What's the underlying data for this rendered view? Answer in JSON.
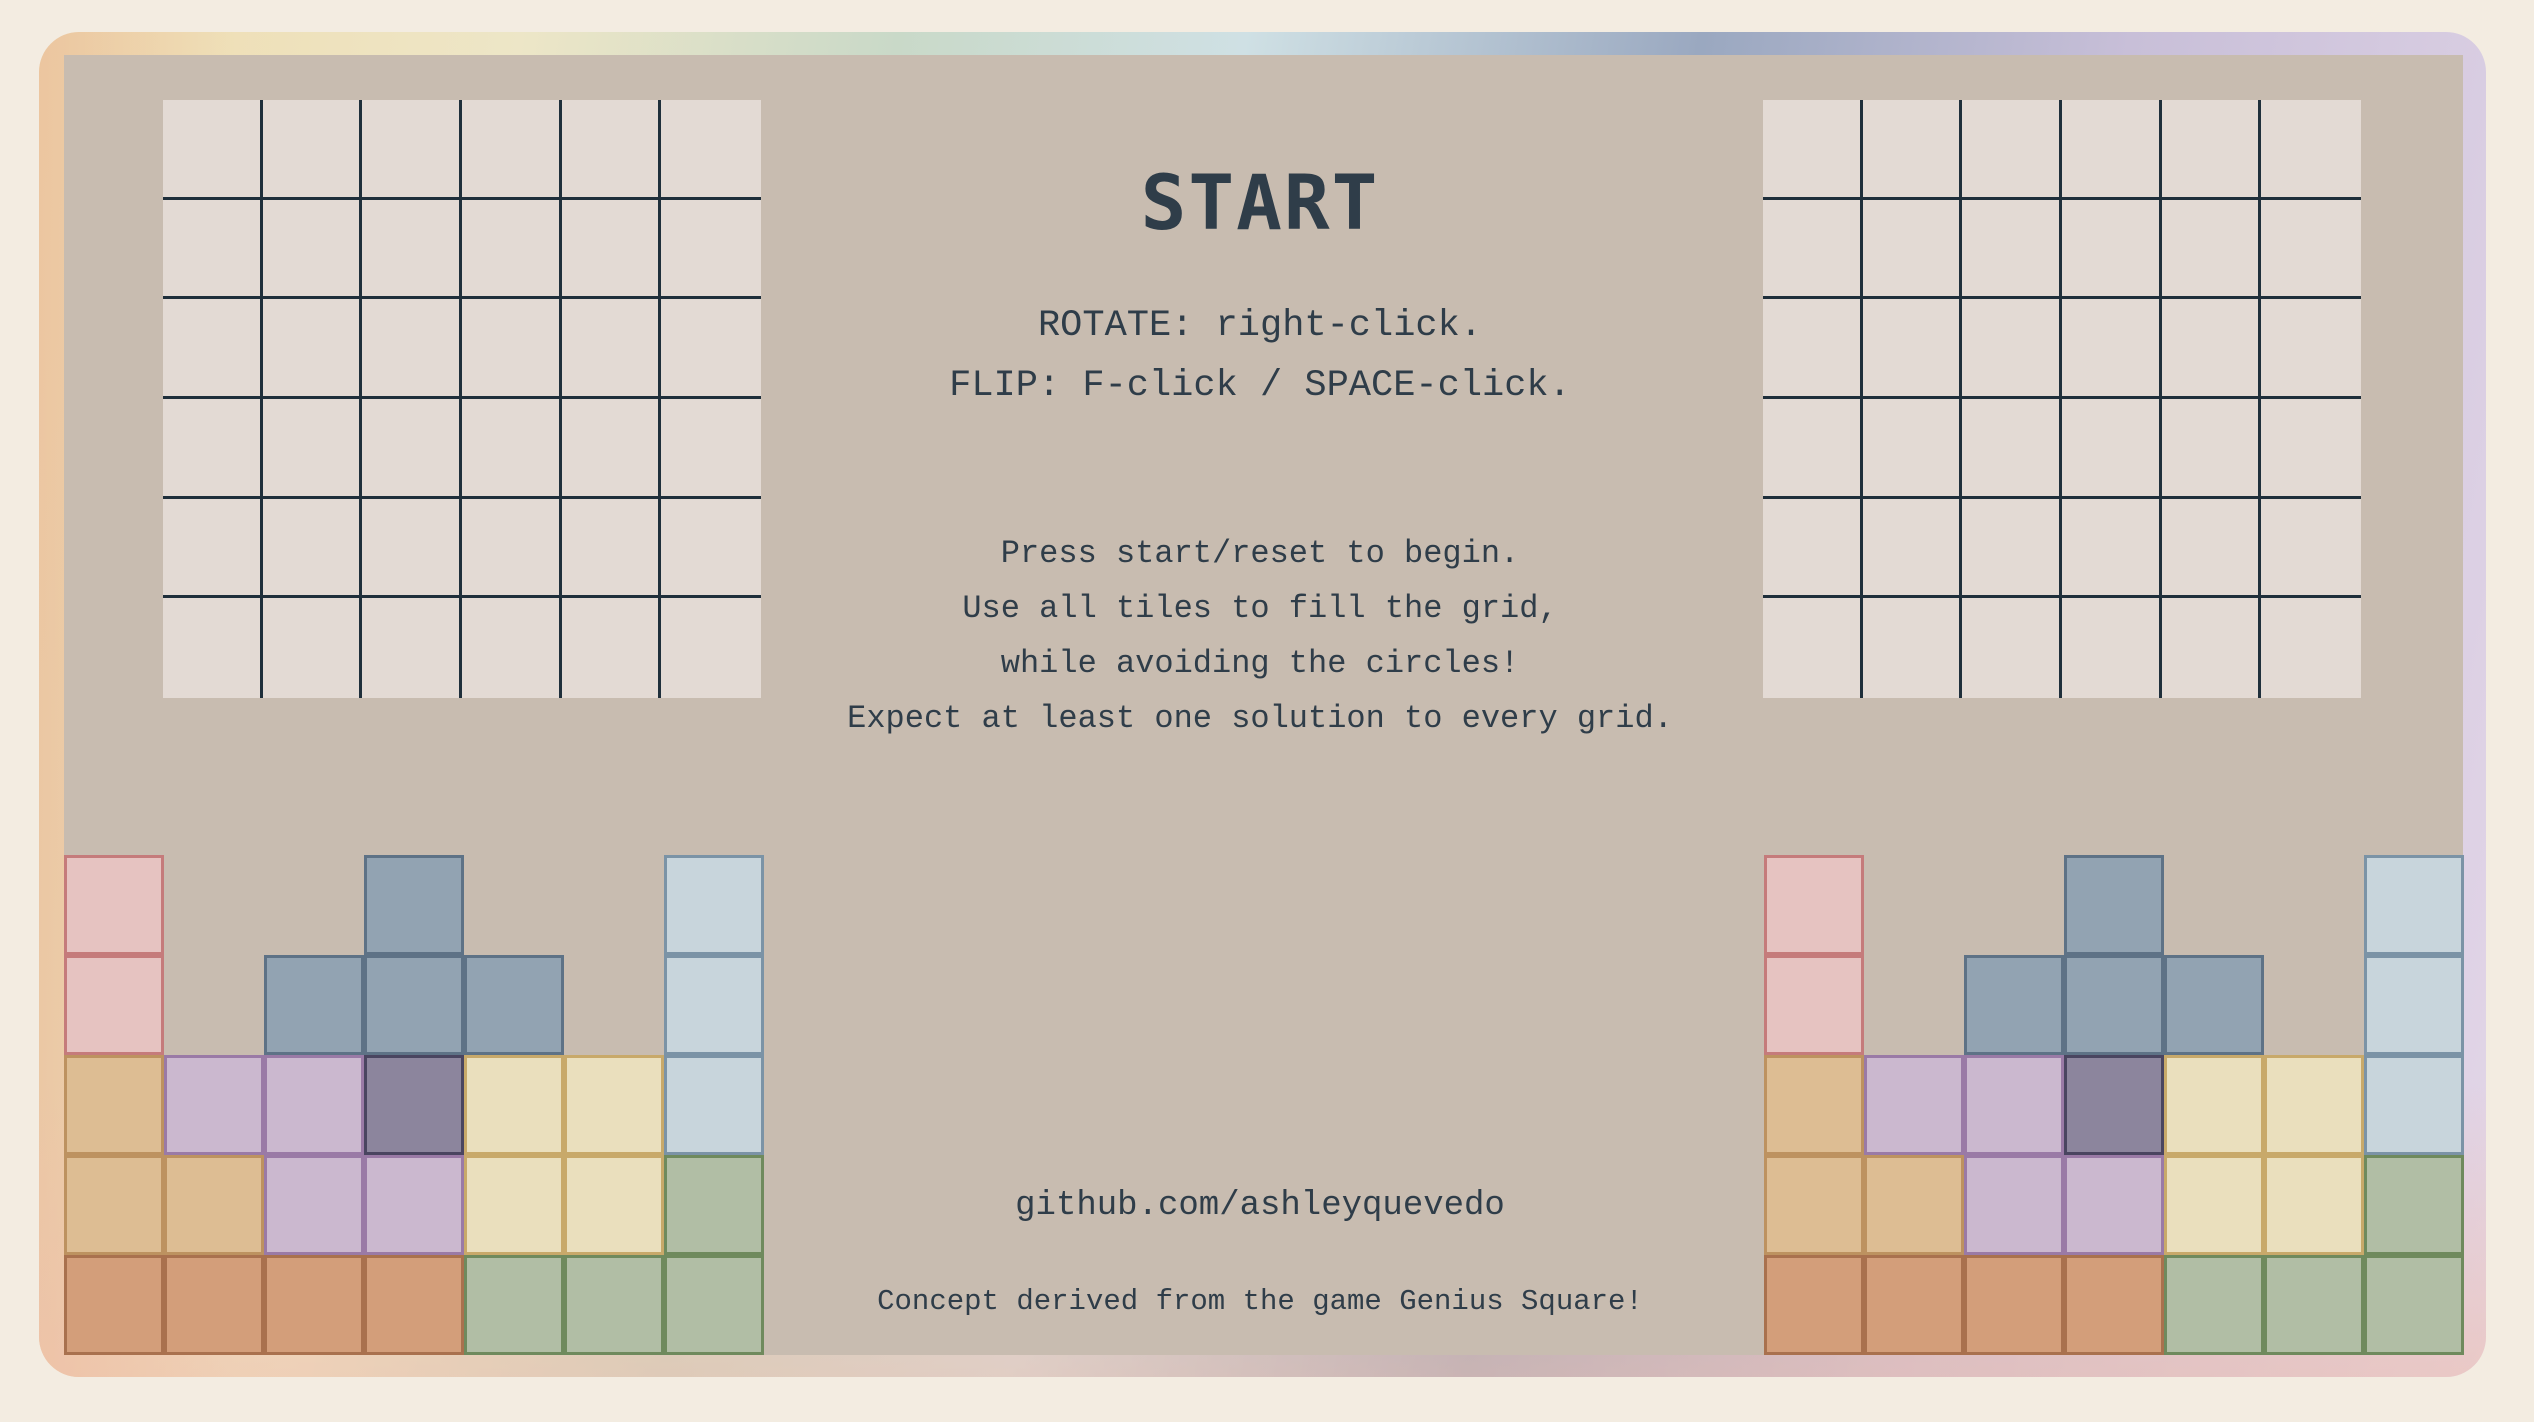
{
  "title": "START",
  "controls": {
    "rotate": "ROTATE: right-click.",
    "flip": "FLIP: F-click / SPACE-click."
  },
  "instructions": [
    "Press start/reset to begin.",
    "Use all tiles to fill the grid,",
    "while avoiding the circles!",
    "Expect at least one solution to every grid."
  ],
  "footer": {
    "github": "github.com/ashleyquevedo",
    "credit": "Concept derived from the game Genius Square!"
  },
  "grid": {
    "rows": 6,
    "cols": 6
  },
  "piece_colors": {
    "red": "#e6c3c1",
    "blue": "#92a3b2",
    "lightblue": "#c8d5dc",
    "tan": "#ddbd93",
    "lilac": "#cbb8cf",
    "dark_purple": "#8c859d",
    "cream": "#eadfbd",
    "green": "#b1bea5",
    "orange": "#d39e7a"
  },
  "pieces": [
    {
      "name": "red-domino",
      "color": "red",
      "cells": [
        [
          0,
          0
        ],
        [
          0,
          1
        ]
      ]
    },
    {
      "name": "blue-t",
      "color": "blue",
      "cells": [
        [
          3,
          0
        ],
        [
          2,
          1
        ],
        [
          3,
          1
        ],
        [
          4,
          1
        ]
      ]
    },
    {
      "name": "lightblue-i",
      "color": "lightblue",
      "cells": [
        [
          6,
          0
        ],
        [
          6,
          1
        ],
        [
          6,
          2
        ]
      ]
    },
    {
      "name": "tan-l",
      "color": "tan",
      "cells": [
        [
          0,
          2
        ],
        [
          0,
          3
        ],
        [
          1,
          3
        ]
      ]
    },
    {
      "name": "lilac-s",
      "color": "lilac",
      "cells": [
        [
          1,
          2
        ],
        [
          2,
          2
        ],
        [
          2,
          3
        ],
        [
          3,
          3
        ]
      ]
    },
    {
      "name": "dark-purple-mono",
      "color": "dark_purple",
      "cells": [
        [
          3,
          2
        ]
      ]
    },
    {
      "name": "cream-square",
      "color": "cream",
      "cells": [
        [
          4,
          2
        ],
        [
          5,
          2
        ],
        [
          4,
          3
        ],
        [
          5,
          3
        ]
      ]
    },
    {
      "name": "orange-i",
      "color": "orange",
      "cells": [
        [
          0,
          4
        ],
        [
          1,
          4
        ],
        [
          2,
          4
        ],
        [
          3,
          4
        ]
      ]
    },
    {
      "name": "green-l",
      "color": "green",
      "cells": [
        [
          6,
          3
        ],
        [
          4,
          4
        ],
        [
          5,
          4
        ],
        [
          6,
          4
        ]
      ]
    }
  ]
}
